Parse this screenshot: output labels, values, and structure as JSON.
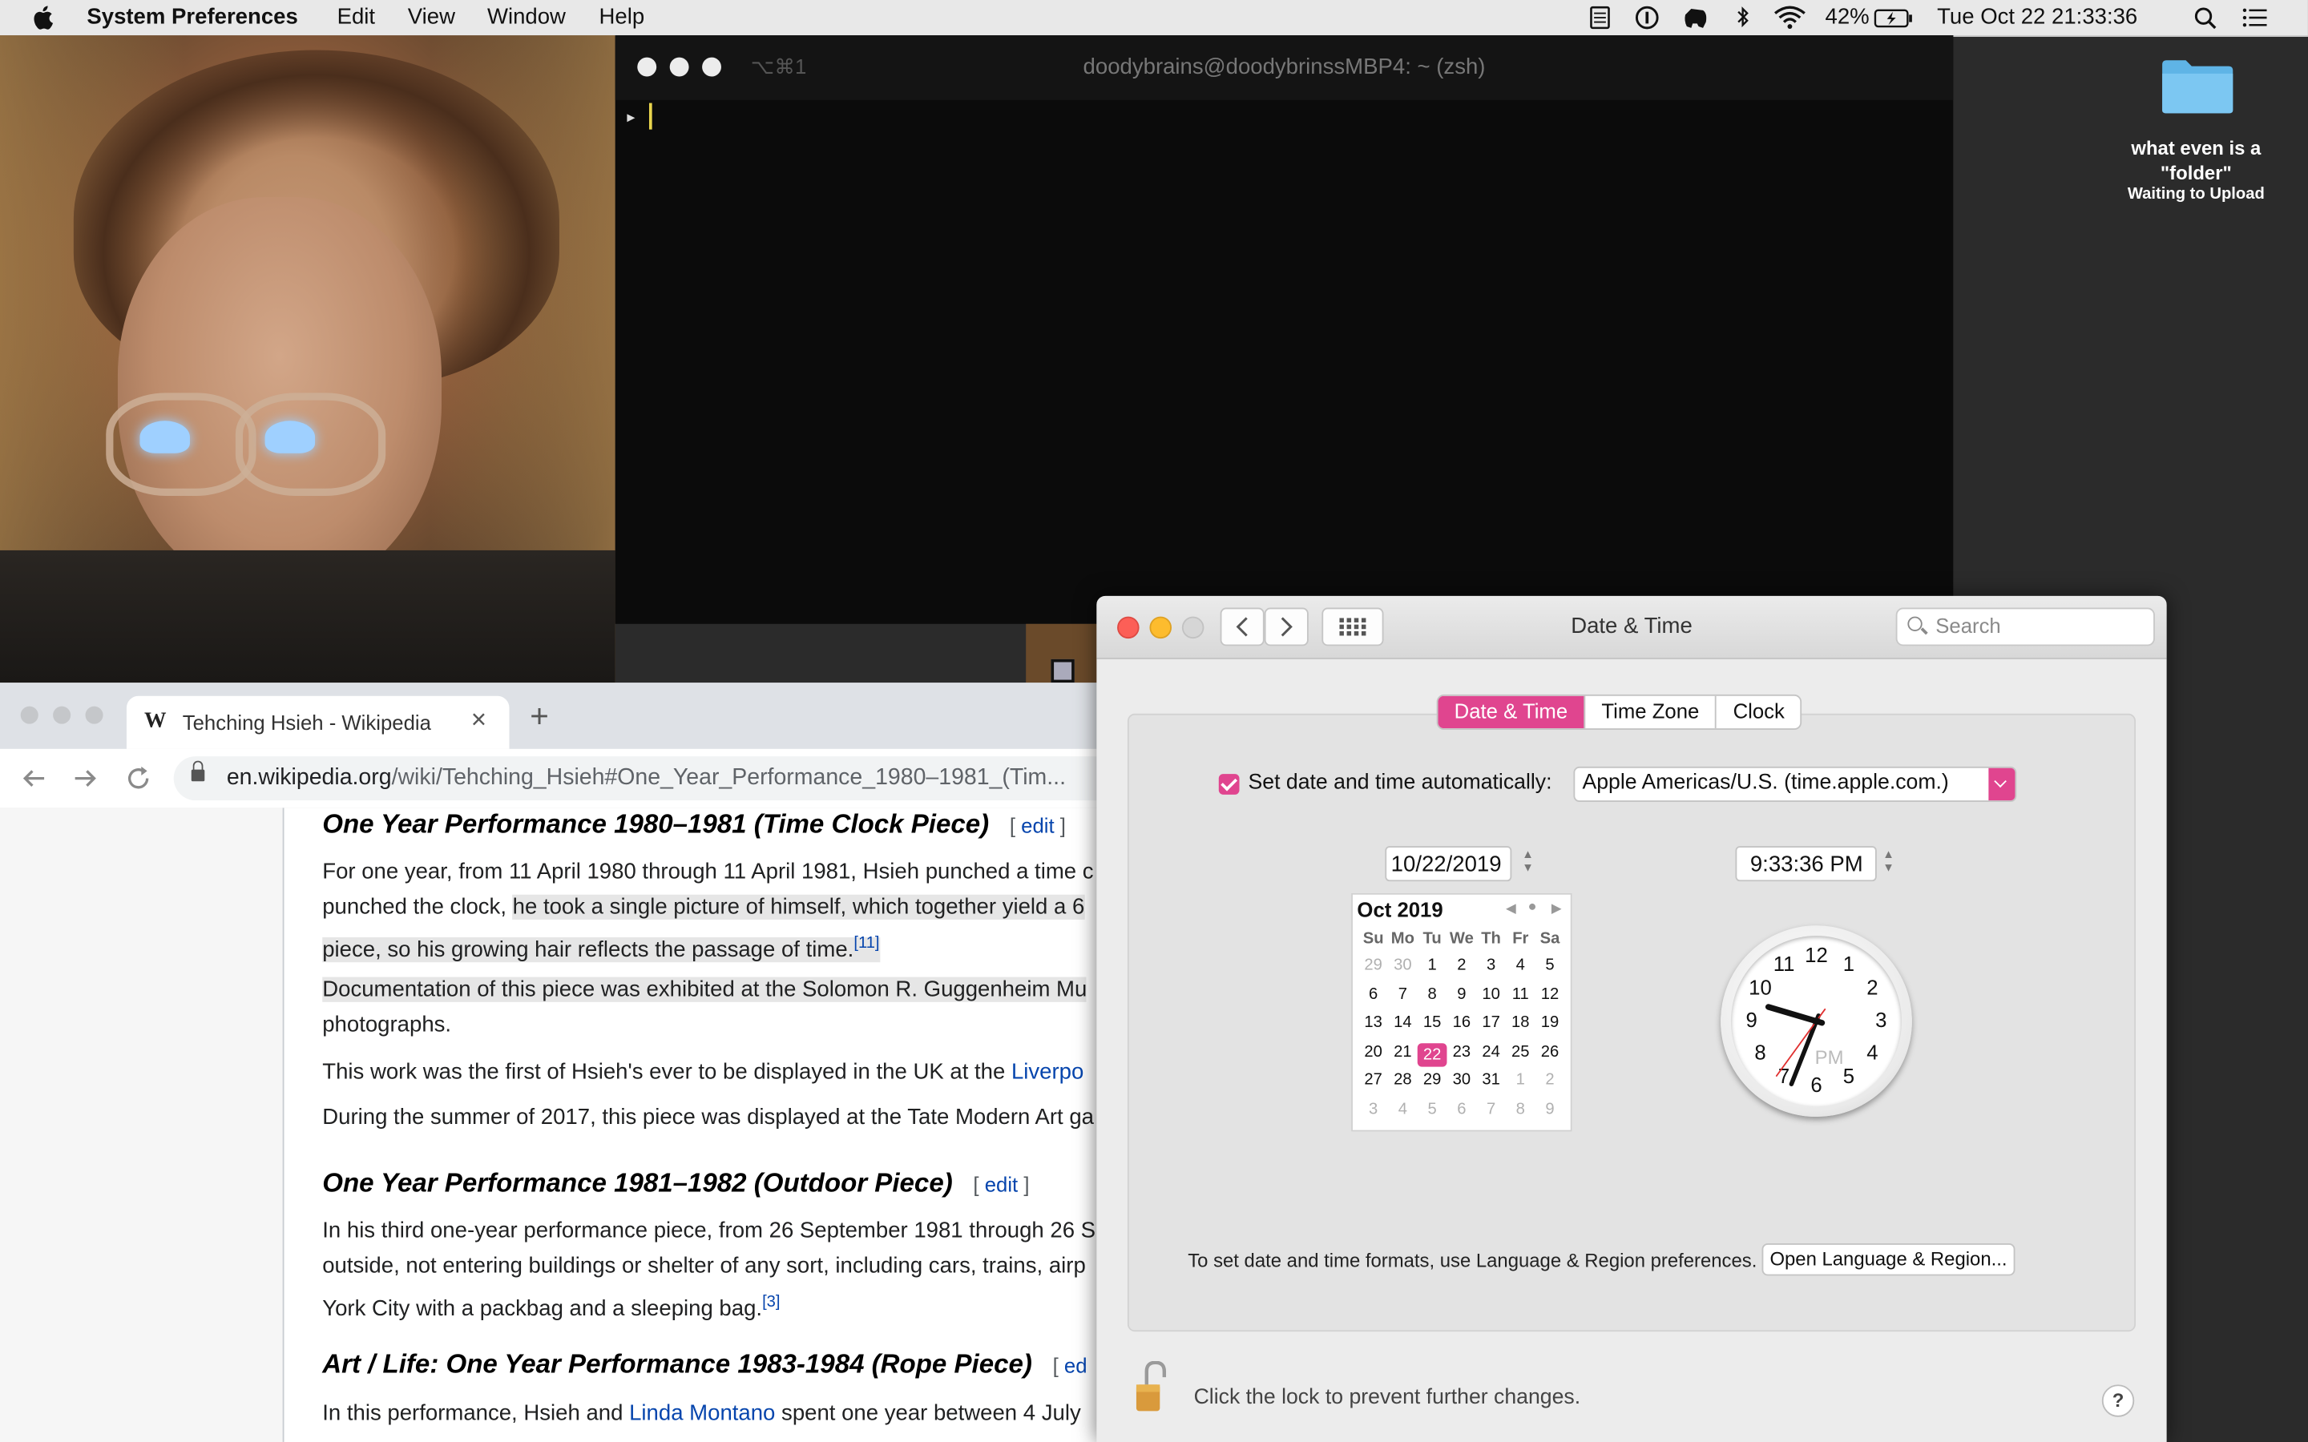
{
  "menubar": {
    "app_name": "System Preferences",
    "items": [
      "Edit",
      "View",
      "Window",
      "Help"
    ],
    "battery": "42%",
    "clock": "Tue Oct 22  21:33:36"
  },
  "terminal": {
    "shortcut": "⌥⌘1",
    "title": "doodybrains@doodybrinssMBP4: ~ (zsh)",
    "prompt": "▸"
  },
  "desktop": {
    "folder_name_1": "what even is a",
    "folder_name_2": "\"folder\"",
    "folder_status": "Waiting to Upload"
  },
  "browser": {
    "tab_logo": "W",
    "tab_title": "Tehching Hsieh - Wikipedia",
    "tab_close": "×",
    "new_tab": "+",
    "url_domain": "en.wikipedia.org",
    "url_path": "/wiki/Tehching_Hsieh#One_Year_Performance_1980–1981_(Tim...",
    "sections": {
      "h1": "One Year Performance 1980–1981 (Time Clock Piece)",
      "h2": "One Year Performance 1981–1982 (Outdoor Piece)",
      "h3": "Art / Life: One Year Performance 1983-1984 (Rope Piece)",
      "edit": "edit",
      "edit_cut": "ed"
    },
    "paragraphs": {
      "p1a": "For one year, from 11 April 1980 through 11 April 1981, Hsieh punched a time c",
      "p1b_pre": "punched the clock, ",
      "p1b_hl": "he took a single picture of himself, which together yield a 6",
      "p1c": "piece, so his growing hair reflects the passage of time.",
      "ref11": "[11]",
      "p2a": "Documentation of this piece was exhibited at the Solomon R. Guggenheim Mu",
      "p2b": "photographs.",
      "p3_pre": "This work was the first of Hsieh's ever to be displayed in the UK at the ",
      "p3_link": "Liverpo",
      "p4": "During the summer of 2017, this piece was displayed at the Tate Modern Art ga",
      "p5a": "In his third one-year performance piece, from 26 September 1981 through 26 S",
      "p5b": "outside, not entering buildings or shelter of any sort, including cars, trains, airp",
      "p5c": "York City with a packbag and a sleeping bag.",
      "ref3": "[3]",
      "p6_pre": "In this performance, Hsieh and ",
      "p6_link": "Linda Montano",
      "p6_post": " spent one year between 4 July"
    }
  },
  "sysprefs": {
    "window_title": "Date & Time",
    "search_placeholder": "Search",
    "tabs": [
      "Date & Time",
      "Time Zone",
      "Clock"
    ],
    "auto_label": "Set date and time automatically:",
    "server": "Apple Americas/U.S. (time.apple.com.)",
    "date_value": "10/22/2019",
    "time_value": "9:33:36 PM",
    "calendar": {
      "month": "Oct 2019",
      "days_header": [
        "Su",
        "Mo",
        "Tu",
        "We",
        "Th",
        "Fr",
        "Sa"
      ],
      "weeks": [
        [
          "29",
          "30",
          "1",
          "2",
          "3",
          "4",
          "5"
        ],
        [
          "6",
          "7",
          "8",
          "9",
          "10",
          "11",
          "12"
        ],
        [
          "13",
          "14",
          "15",
          "16",
          "17",
          "18",
          "19"
        ],
        [
          "20",
          "21",
          "22",
          "23",
          "24",
          "25",
          "26"
        ],
        [
          "27",
          "28",
          "29",
          "30",
          "31",
          "1",
          "2"
        ],
        [
          "3",
          "4",
          "5",
          "6",
          "7",
          "8",
          "9"
        ]
      ],
      "selected_day": "22"
    },
    "clock_numbers": [
      "12",
      "1",
      "2",
      "3",
      "4",
      "5",
      "6",
      "7",
      "8",
      "9",
      "10",
      "11"
    ],
    "clock_pm": "PM",
    "clock_time": {
      "hour": 9,
      "minute": 33,
      "second": 36
    },
    "format_text": "To set date and time formats, use Language & Region preferences.",
    "format_button": "Open Language & Region...",
    "lock_text": "Click the lock to prevent further changes.",
    "help": "?"
  },
  "colors": {
    "accent": "#e0458f",
    "link": "#0645ad"
  }
}
